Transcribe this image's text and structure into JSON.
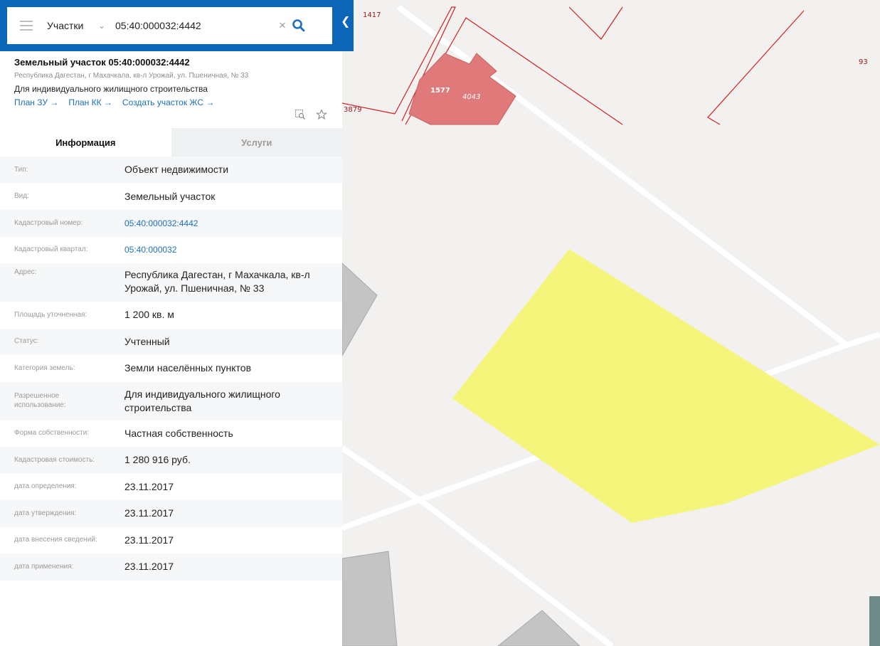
{
  "search": {
    "layer": "Участки",
    "query": "05:40:000032:4442"
  },
  "card": {
    "title": "Земельный участок 05:40:000032:4442",
    "address": "Республика Дагестан, г Махачкала, кв-л Урожай, ул. Пшеничная, № 33",
    "use": "Для индивидуального жилищного строительства",
    "links": [
      "План ЗУ →",
      "План КК →",
      "Создать участок ЖС →"
    ]
  },
  "tabs": [
    "Информация",
    "Услуги"
  ],
  "rows": [
    {
      "label": "Тип:",
      "value": "Объект недвижимости"
    },
    {
      "label": "Вид:",
      "value": "Земельный участок"
    },
    {
      "label": "Кадастровый номер:",
      "value": "05:40:000032:4442"
    },
    {
      "label": "Кадастровый квартал:",
      "value": "05:40:000032"
    },
    {
      "label": "Адрес:",
      "value": "Республика Дагестан, г Махачкала, кв-л Урожай, ул. Пшеничная, № 33"
    },
    {
      "label": "Площадь уточненная:",
      "value": "1 200 кв. м"
    },
    {
      "label": "Статус:",
      "value": "Учтенный"
    },
    {
      "label": "Категория земель:",
      "value": "Земли населённых пунктов"
    },
    {
      "label": "Разрешенное использование:",
      "value": "Для индивидуального жилищного строительства"
    },
    {
      "label": "Форма собственности:",
      "value": "Частная собственность"
    },
    {
      "label": "Кадастровая стоимость:",
      "value": "1 280 916 руб."
    },
    {
      "label": "дата определения:",
      "value": "23.11.2017"
    },
    {
      "label": "дата утверждения:",
      "value": "23.11.2017"
    },
    {
      "label": "дата внесения сведений:",
      "value": "23.11.2017"
    },
    {
      "label": "дата применения:",
      "value": "23.11.2017"
    }
  ],
  "map": {
    "labels": [
      "1417",
      "93",
      "1577",
      "4043",
      "3879"
    ],
    "colors": {
      "background": "#f2f1ef",
      "road": "#ffffff",
      "boundary": "#d42020",
      "building": "#c4c4c4",
      "highlight_parcel": "#f5f56b",
      "pink_building": "#e07a7a",
      "accent": "#0b66b8"
    }
  }
}
